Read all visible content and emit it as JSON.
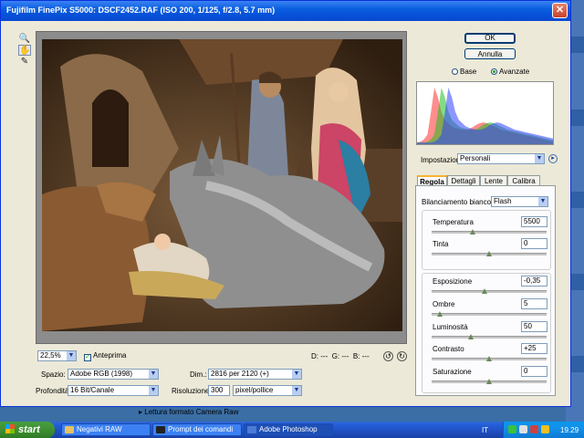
{
  "window": {
    "title": "Fujifilm FinePix S5000:  DSCF2452.RAF  (ISO 200, 1/125, f/2.8, 5.7 mm)",
    "close_glyph": "✕"
  },
  "tools": [
    {
      "name": "zoom-tool-icon",
      "glyph": "🔍"
    },
    {
      "name": "hand-tool-icon",
      "glyph": "✋"
    },
    {
      "name": "eyedropper-tool-icon",
      "glyph": "✎"
    }
  ],
  "buttons": {
    "ok": "OK",
    "cancel": "Annulla"
  },
  "view_mode": {
    "base": "Base",
    "advanced": "Avanzate",
    "selected": "Avanzate"
  },
  "settings": {
    "label": "Impostazioni:",
    "value": "Personali",
    "menu_glyph": "▸"
  },
  "tabs": [
    {
      "label": "Regola",
      "active": true
    },
    {
      "label": "Dettagli",
      "active": false
    },
    {
      "label": "Lente",
      "active": false
    },
    {
      "label": "Calibra",
      "active": false
    }
  ],
  "white_balance": {
    "label": "Bilanciamento bianco:",
    "value": "Flash"
  },
  "adjustments": [
    {
      "label": "Temperatura",
      "value": "5500",
      "position": 0.35
    },
    {
      "label": "Tinta",
      "value": "0",
      "position": 0.5
    },
    {
      "label": "Esposizione",
      "value": "-0,35",
      "position": 0.46
    },
    {
      "label": "Ombre",
      "value": "5",
      "position": 0.05
    },
    {
      "label": "Luminosità",
      "value": "50",
      "position": 0.33
    },
    {
      "label": "Contrasto",
      "value": "+25",
      "position": 0.5
    },
    {
      "label": "Saturazione",
      "value": "0",
      "position": 0.5
    }
  ],
  "preview_bar": {
    "zoom": "22,5%",
    "preview_label": "Anteprima",
    "preview_checked": true,
    "readout": {
      "d": "D:",
      "g": "G:",
      "b": "B:",
      "dash": "---"
    }
  },
  "output": {
    "space_label": "Spazio:",
    "space_value": "Adobe RGB (1998)",
    "depth_label": "Profondità:",
    "depth_value": "16 Bit/Canale",
    "size_label": "Dim.:",
    "size_value": "2816 per 2120  (+)",
    "resolution_label": "Risoluzione:",
    "resolution_value": "300",
    "resolution_unit": "pixel/pollice"
  },
  "status": "Lettura formato Camera Raw",
  "taskbar": {
    "start": "start",
    "tasks": [
      {
        "label": "Negativi RAW",
        "active": false,
        "color": "#e8c160"
      },
      {
        "label": "Prompt dei comandi",
        "active": false,
        "color": "#222222"
      },
      {
        "label": "Adobe Photoshop",
        "active": true,
        "color": "#4a7bd6"
      }
    ],
    "language": "IT",
    "clock": "19.29"
  },
  "histogram": {
    "channels": [
      "red",
      "green",
      "blue"
    ],
    "profile": [
      2,
      3,
      6,
      12,
      40,
      70,
      58,
      40,
      30,
      26,
      22,
      20,
      19,
      18,
      18,
      19,
      21,
      24,
      26,
      27,
      26,
      24,
      22,
      20,
      18,
      17,
      16,
      15,
      14,
      13,
      12,
      11,
      10,
      9,
      8,
      7,
      6,
      5,
      4,
      3
    ]
  }
}
